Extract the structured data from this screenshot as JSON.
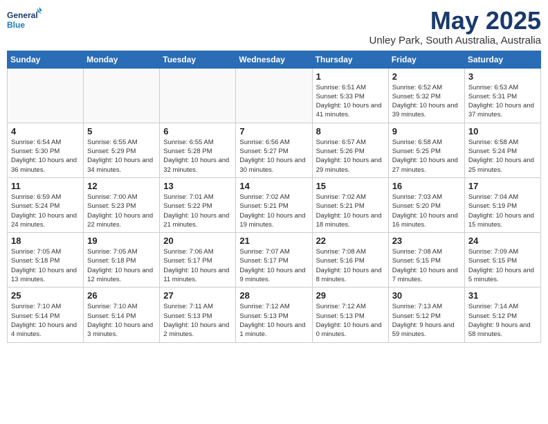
{
  "logo": {
    "line1": "General",
    "line2": "Blue"
  },
  "title": "May 2025",
  "subtitle": "Unley Park, South Australia, Australia",
  "days_of_week": [
    "Sunday",
    "Monday",
    "Tuesday",
    "Wednesday",
    "Thursday",
    "Friday",
    "Saturday"
  ],
  "weeks": [
    [
      {
        "day": "",
        "info": ""
      },
      {
        "day": "",
        "info": ""
      },
      {
        "day": "",
        "info": ""
      },
      {
        "day": "",
        "info": ""
      },
      {
        "day": "1",
        "info": "Sunrise: 6:51 AM\nSunset: 5:33 PM\nDaylight: 10 hours\nand 41 minutes."
      },
      {
        "day": "2",
        "info": "Sunrise: 6:52 AM\nSunset: 5:32 PM\nDaylight: 10 hours\nand 39 minutes."
      },
      {
        "day": "3",
        "info": "Sunrise: 6:53 AM\nSunset: 5:31 PM\nDaylight: 10 hours\nand 37 minutes."
      }
    ],
    [
      {
        "day": "4",
        "info": "Sunrise: 6:54 AM\nSunset: 5:30 PM\nDaylight: 10 hours\nand 36 minutes."
      },
      {
        "day": "5",
        "info": "Sunrise: 6:55 AM\nSunset: 5:29 PM\nDaylight: 10 hours\nand 34 minutes."
      },
      {
        "day": "6",
        "info": "Sunrise: 6:55 AM\nSunset: 5:28 PM\nDaylight: 10 hours\nand 32 minutes."
      },
      {
        "day": "7",
        "info": "Sunrise: 6:56 AM\nSunset: 5:27 PM\nDaylight: 10 hours\nand 30 minutes."
      },
      {
        "day": "8",
        "info": "Sunrise: 6:57 AM\nSunset: 5:26 PM\nDaylight: 10 hours\nand 29 minutes."
      },
      {
        "day": "9",
        "info": "Sunrise: 6:58 AM\nSunset: 5:25 PM\nDaylight: 10 hours\nand 27 minutes."
      },
      {
        "day": "10",
        "info": "Sunrise: 6:58 AM\nSunset: 5:24 PM\nDaylight: 10 hours\nand 25 minutes."
      }
    ],
    [
      {
        "day": "11",
        "info": "Sunrise: 6:59 AM\nSunset: 5:24 PM\nDaylight: 10 hours\nand 24 minutes."
      },
      {
        "day": "12",
        "info": "Sunrise: 7:00 AM\nSunset: 5:23 PM\nDaylight: 10 hours\nand 22 minutes."
      },
      {
        "day": "13",
        "info": "Sunrise: 7:01 AM\nSunset: 5:22 PM\nDaylight: 10 hours\nand 21 minutes."
      },
      {
        "day": "14",
        "info": "Sunrise: 7:02 AM\nSunset: 5:21 PM\nDaylight: 10 hours\nand 19 minutes."
      },
      {
        "day": "15",
        "info": "Sunrise: 7:02 AM\nSunset: 5:21 PM\nDaylight: 10 hours\nand 18 minutes."
      },
      {
        "day": "16",
        "info": "Sunrise: 7:03 AM\nSunset: 5:20 PM\nDaylight: 10 hours\nand 16 minutes."
      },
      {
        "day": "17",
        "info": "Sunrise: 7:04 AM\nSunset: 5:19 PM\nDaylight: 10 hours\nand 15 minutes."
      }
    ],
    [
      {
        "day": "18",
        "info": "Sunrise: 7:05 AM\nSunset: 5:18 PM\nDaylight: 10 hours\nand 13 minutes."
      },
      {
        "day": "19",
        "info": "Sunrise: 7:05 AM\nSunset: 5:18 PM\nDaylight: 10 hours\nand 12 minutes."
      },
      {
        "day": "20",
        "info": "Sunrise: 7:06 AM\nSunset: 5:17 PM\nDaylight: 10 hours\nand 11 minutes."
      },
      {
        "day": "21",
        "info": "Sunrise: 7:07 AM\nSunset: 5:17 PM\nDaylight: 10 hours\nand 9 minutes."
      },
      {
        "day": "22",
        "info": "Sunrise: 7:08 AM\nSunset: 5:16 PM\nDaylight: 10 hours\nand 8 minutes."
      },
      {
        "day": "23",
        "info": "Sunrise: 7:08 AM\nSunset: 5:15 PM\nDaylight: 10 hours\nand 7 minutes."
      },
      {
        "day": "24",
        "info": "Sunrise: 7:09 AM\nSunset: 5:15 PM\nDaylight: 10 hours\nand 5 minutes."
      }
    ],
    [
      {
        "day": "25",
        "info": "Sunrise: 7:10 AM\nSunset: 5:14 PM\nDaylight: 10 hours\nand 4 minutes."
      },
      {
        "day": "26",
        "info": "Sunrise: 7:10 AM\nSunset: 5:14 PM\nDaylight: 10 hours\nand 3 minutes."
      },
      {
        "day": "27",
        "info": "Sunrise: 7:11 AM\nSunset: 5:13 PM\nDaylight: 10 hours\nand 2 minutes."
      },
      {
        "day": "28",
        "info": "Sunrise: 7:12 AM\nSunset: 5:13 PM\nDaylight: 10 hours\nand 1 minute."
      },
      {
        "day": "29",
        "info": "Sunrise: 7:12 AM\nSunset: 5:13 PM\nDaylight: 10 hours\nand 0 minutes."
      },
      {
        "day": "30",
        "info": "Sunrise: 7:13 AM\nSunset: 5:12 PM\nDaylight: 9 hours\nand 59 minutes."
      },
      {
        "day": "31",
        "info": "Sunrise: 7:14 AM\nSunset: 5:12 PM\nDaylight: 9 hours\nand 58 minutes."
      }
    ]
  ]
}
